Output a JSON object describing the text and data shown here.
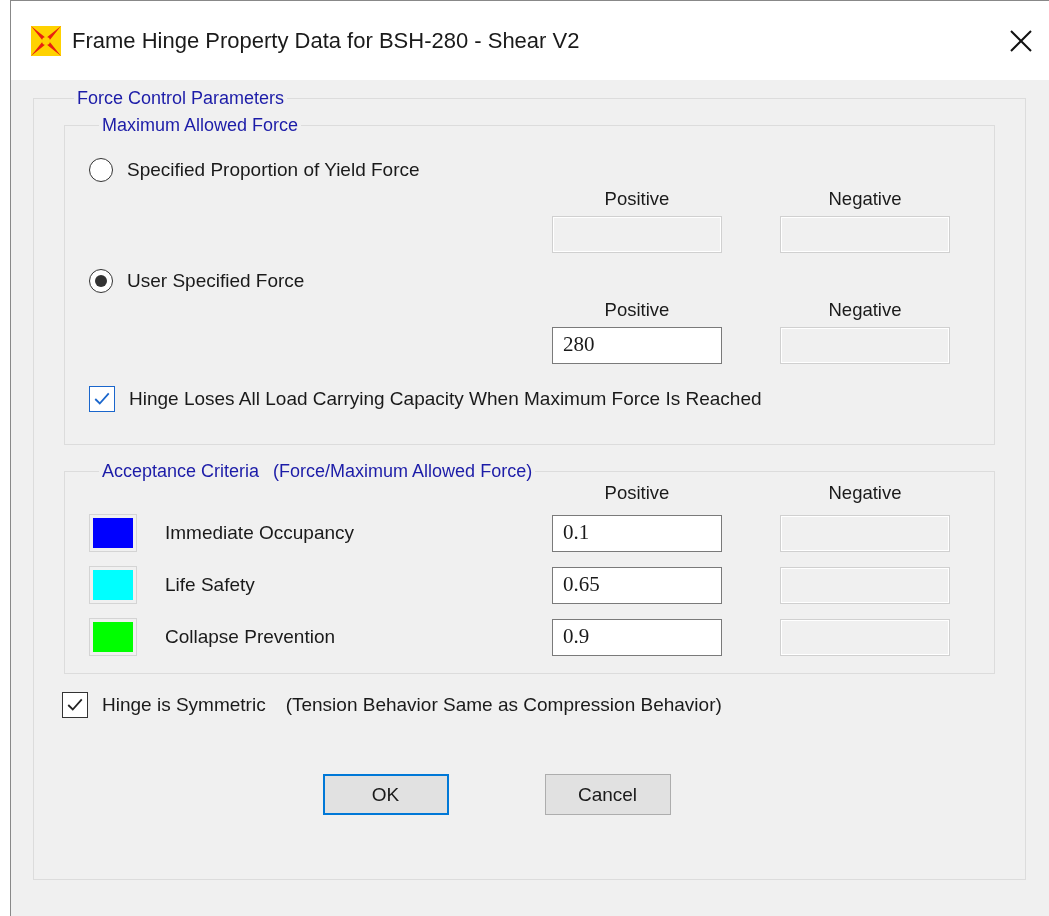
{
  "window": {
    "title": "Frame Hinge Property Data for BSH-280 - Shear V2"
  },
  "force_control": {
    "title": "Force Control Parameters",
    "maximum_allowed_force": {
      "title": "Maximum Allowed Force",
      "options": [
        {
          "label": "Specified Proportion of Yield Force",
          "selected": false,
          "positive_label": "Positive",
          "negative_label": "Negative",
          "positive": {
            "disabled": true
          },
          "negative": {
            "disabled": true
          }
        },
        {
          "label": "User Specified Force",
          "selected": true,
          "positive_label": "Positive",
          "negative_label": "Negative",
          "positive": {
            "value": "280",
            "disabled": false
          },
          "negative": {
            "disabled": true
          }
        }
      ],
      "loses_capacity": {
        "label": "Hinge Loses All Load Carrying Capacity When Maximum Force Is Reached",
        "checked": true
      }
    },
    "acceptance_criteria": {
      "title": "Acceptance Criteria",
      "subtitle": "(Force/Maximum Allowed Force)",
      "positive_label": "Positive",
      "negative_label": "Negative",
      "rows": [
        {
          "label": "Immediate Occupancy",
          "color": "#0000ff",
          "positive": "0.1",
          "negative_disabled": true
        },
        {
          "label": "Life Safety",
          "color": "#00ffff",
          "positive": "0.65",
          "negative_disabled": true
        },
        {
          "label": "Collapse Prevention",
          "color": "#00ff00",
          "positive": "0.9",
          "negative_disabled": true
        }
      ]
    },
    "symmetric": {
      "label": "Hinge is Symmetric",
      "note": "(Tension Behavior Same as Compression Behavior)",
      "checked": true
    }
  },
  "buttons": [
    {
      "label": "OK",
      "default": true
    },
    {
      "label": "Cancel",
      "default": false
    }
  ]
}
